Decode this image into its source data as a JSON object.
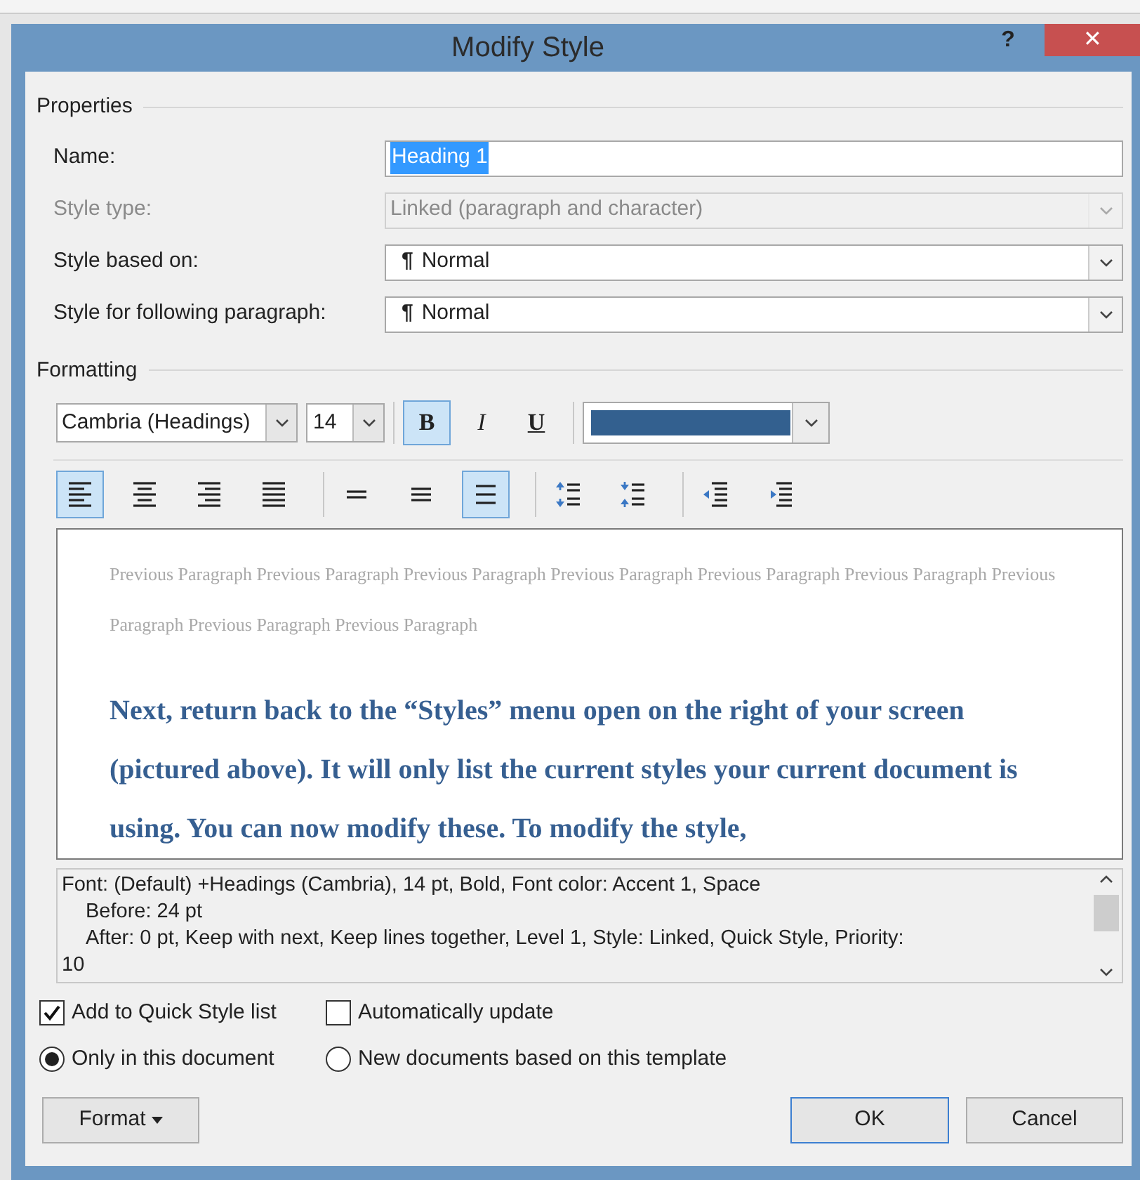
{
  "window": {
    "title": "Modify Style",
    "help": "?",
    "close": "✕"
  },
  "properties": {
    "heading": "Properties",
    "rows": [
      {
        "label": "Name:",
        "value": "Heading 1",
        "kind": "text",
        "disabled": false,
        "highlighted": true
      },
      {
        "label": "Style type:",
        "value": "Linked (paragraph and character)",
        "kind": "select",
        "disabled": true,
        "highlighted": false
      },
      {
        "label": "Style based on:",
        "value": "Normal",
        "mark": "¶",
        "kind": "select",
        "disabled": false,
        "highlighted": false
      },
      {
        "label": "Style for following paragraph:",
        "value": "Normal",
        "mark": "¶",
        "kind": "select",
        "disabled": false,
        "highlighted": false
      }
    ]
  },
  "formatting": {
    "heading": "Formatting",
    "font": "Cambria (Headings)",
    "size": "14",
    "style_buttons": [
      {
        "label": "B",
        "kind": "bold",
        "selected": true
      },
      {
        "label": "I",
        "kind": "italic",
        "selected": false
      },
      {
        "label": "U",
        "kind": "underline",
        "selected": false
      }
    ],
    "font_color": {
      "color": "#33608f"
    },
    "paragraph_buttons": [
      {
        "kind": "align-left",
        "selected": true
      },
      {
        "kind": "align-center",
        "selected": false
      },
      {
        "kind": "align-right",
        "selected": false
      },
      {
        "kind": "justify",
        "selected": false
      },
      {
        "kind": "single-spacing",
        "selected": false
      },
      {
        "kind": "one-half-spacing",
        "selected": false
      },
      {
        "kind": "double-spacing",
        "selected": true
      },
      {
        "kind": "increase-spacing",
        "selected": false
      },
      {
        "kind": "decrease-spacing",
        "selected": false
      },
      {
        "kind": "decrease-indent",
        "selected": false
      },
      {
        "kind": "increase-indent",
        "selected": false
      }
    ]
  },
  "preview": {
    "previous_text": "Previous Paragraph Previous Paragraph Previous Paragraph Previous Paragraph Previous Paragraph Previous Paragraph Previous Paragraph Previous Paragraph Previous Paragraph",
    "sample_text": "Next, return back to the “Styles” menu open on the right of your screen (pictured above). It will only list the current styles your current document is using. You can now modify these. To modify the style,"
  },
  "description": {
    "lines": [
      "Font: (Default) +Headings (Cambria), 14 pt, Bold, Font color: Accent 1, Space",
      "Before:  24 pt",
      "After:  0 pt, Keep with next, Keep lines together, Level 1, Style: Linked, Quick Style, Priority:",
      "10"
    ]
  },
  "options": [
    {
      "label": "Add to Quick Style list",
      "kind": "checkbox",
      "checked": true
    },
    {
      "label": "Automatically update",
      "kind": "checkbox",
      "checked": false
    },
    {
      "label": "Only in this document",
      "kind": "radio",
      "checked": true
    },
    {
      "label": "New documents based on this template",
      "kind": "radio",
      "checked": false
    }
  ],
  "buttons": [
    {
      "label": "Format",
      "kind": "menu",
      "default": false
    },
    {
      "label": "OK",
      "kind": "push",
      "default": true
    },
    {
      "label": "Cancel",
      "kind": "push",
      "default": false
    }
  ]
}
